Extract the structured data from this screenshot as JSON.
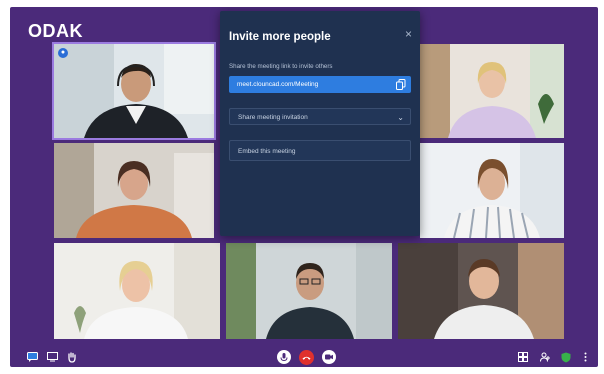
{
  "app": {
    "logo": "ODAK"
  },
  "participants": [
    {
      "name": "tile-man-headset",
      "active": true,
      "badge": "●"
    },
    {
      "name": "tile-woman-blonde-office"
    },
    {
      "name": "tile-woman-orange-top"
    },
    {
      "name": "tile-woman-striped-shirt"
    },
    {
      "name": "tile-woman-older-blonde"
    },
    {
      "name": "tile-man-glasses"
    },
    {
      "name": "tile-man-white-shirt"
    }
  ],
  "dialog": {
    "title": "Invite more people",
    "close": "×",
    "hint": "Share the meeting link to invite others",
    "meeting_link": "meet.clouncad.com/Meeting",
    "share_label": "Share meeting invitation",
    "share_chevron": "⌄",
    "embed_label": "Embed this meeting"
  },
  "toolbar": {
    "left": [
      "chat-icon",
      "screen-share-icon",
      "raise-hand-icon"
    ],
    "center": [
      "microphone-icon",
      "hangup-icon",
      "camera-icon"
    ],
    "right": [
      "tile-view-icon",
      "participants-icon",
      "security-shield-icon",
      "more-options-icon"
    ]
  },
  "colors": {
    "background": "#4b2a7a",
    "dialog": "#1f3150",
    "accent": "#2e7de0",
    "hangup": "#e0312d",
    "active_border": "#9b7be0"
  }
}
